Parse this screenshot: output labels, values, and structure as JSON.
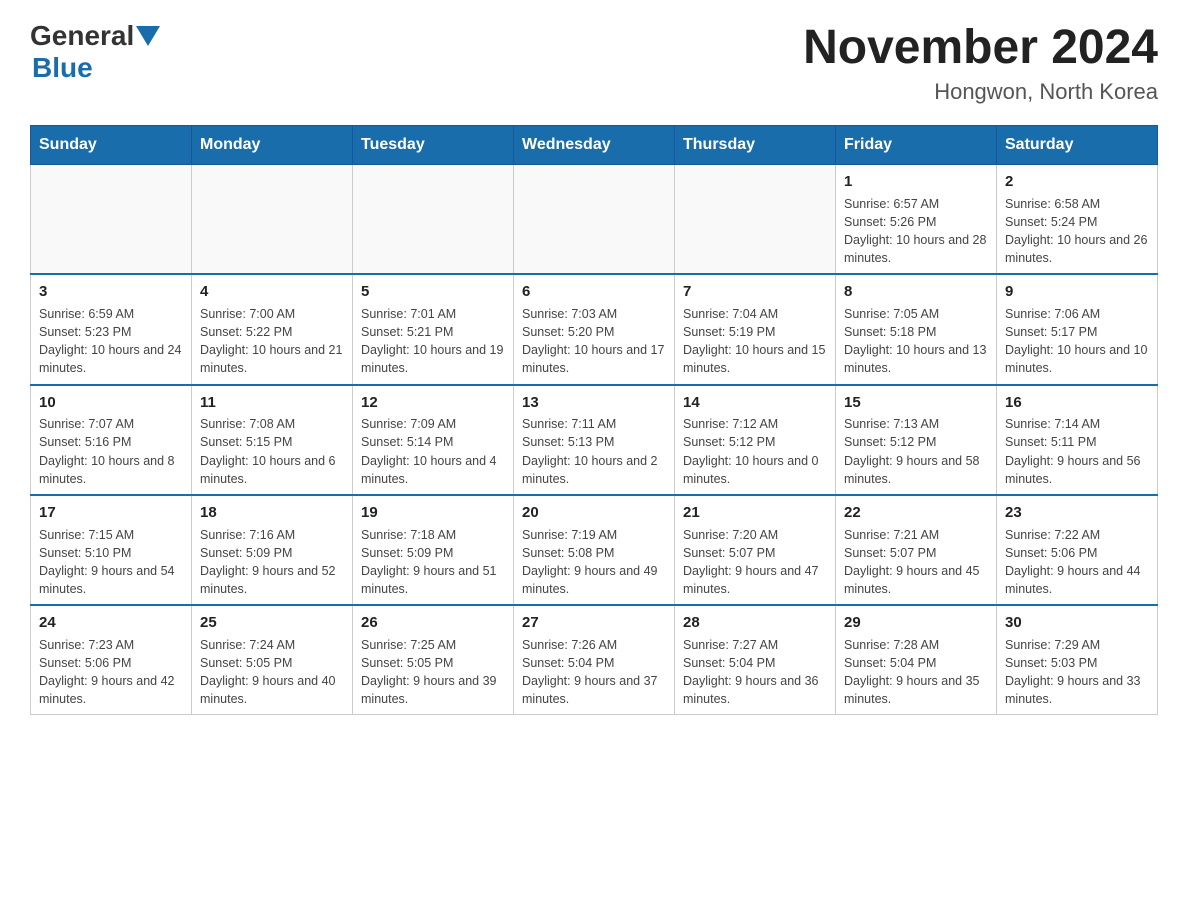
{
  "header": {
    "logo_general": "General",
    "logo_blue": "Blue",
    "month_title": "November 2024",
    "location": "Hongwon, North Korea"
  },
  "days_of_week": [
    "Sunday",
    "Monday",
    "Tuesday",
    "Wednesday",
    "Thursday",
    "Friday",
    "Saturday"
  ],
  "weeks": [
    {
      "days": [
        {
          "num": "",
          "info": ""
        },
        {
          "num": "",
          "info": ""
        },
        {
          "num": "",
          "info": ""
        },
        {
          "num": "",
          "info": ""
        },
        {
          "num": "",
          "info": ""
        },
        {
          "num": "1",
          "info": "Sunrise: 6:57 AM\nSunset: 5:26 PM\nDaylight: 10 hours and 28 minutes."
        },
        {
          "num": "2",
          "info": "Sunrise: 6:58 AM\nSunset: 5:24 PM\nDaylight: 10 hours and 26 minutes."
        }
      ]
    },
    {
      "days": [
        {
          "num": "3",
          "info": "Sunrise: 6:59 AM\nSunset: 5:23 PM\nDaylight: 10 hours and 24 minutes."
        },
        {
          "num": "4",
          "info": "Sunrise: 7:00 AM\nSunset: 5:22 PM\nDaylight: 10 hours and 21 minutes."
        },
        {
          "num": "5",
          "info": "Sunrise: 7:01 AM\nSunset: 5:21 PM\nDaylight: 10 hours and 19 minutes."
        },
        {
          "num": "6",
          "info": "Sunrise: 7:03 AM\nSunset: 5:20 PM\nDaylight: 10 hours and 17 minutes."
        },
        {
          "num": "7",
          "info": "Sunrise: 7:04 AM\nSunset: 5:19 PM\nDaylight: 10 hours and 15 minutes."
        },
        {
          "num": "8",
          "info": "Sunrise: 7:05 AM\nSunset: 5:18 PM\nDaylight: 10 hours and 13 minutes."
        },
        {
          "num": "9",
          "info": "Sunrise: 7:06 AM\nSunset: 5:17 PM\nDaylight: 10 hours and 10 minutes."
        }
      ]
    },
    {
      "days": [
        {
          "num": "10",
          "info": "Sunrise: 7:07 AM\nSunset: 5:16 PM\nDaylight: 10 hours and 8 minutes."
        },
        {
          "num": "11",
          "info": "Sunrise: 7:08 AM\nSunset: 5:15 PM\nDaylight: 10 hours and 6 minutes."
        },
        {
          "num": "12",
          "info": "Sunrise: 7:09 AM\nSunset: 5:14 PM\nDaylight: 10 hours and 4 minutes."
        },
        {
          "num": "13",
          "info": "Sunrise: 7:11 AM\nSunset: 5:13 PM\nDaylight: 10 hours and 2 minutes."
        },
        {
          "num": "14",
          "info": "Sunrise: 7:12 AM\nSunset: 5:12 PM\nDaylight: 10 hours and 0 minutes."
        },
        {
          "num": "15",
          "info": "Sunrise: 7:13 AM\nSunset: 5:12 PM\nDaylight: 9 hours and 58 minutes."
        },
        {
          "num": "16",
          "info": "Sunrise: 7:14 AM\nSunset: 5:11 PM\nDaylight: 9 hours and 56 minutes."
        }
      ]
    },
    {
      "days": [
        {
          "num": "17",
          "info": "Sunrise: 7:15 AM\nSunset: 5:10 PM\nDaylight: 9 hours and 54 minutes."
        },
        {
          "num": "18",
          "info": "Sunrise: 7:16 AM\nSunset: 5:09 PM\nDaylight: 9 hours and 52 minutes."
        },
        {
          "num": "19",
          "info": "Sunrise: 7:18 AM\nSunset: 5:09 PM\nDaylight: 9 hours and 51 minutes."
        },
        {
          "num": "20",
          "info": "Sunrise: 7:19 AM\nSunset: 5:08 PM\nDaylight: 9 hours and 49 minutes."
        },
        {
          "num": "21",
          "info": "Sunrise: 7:20 AM\nSunset: 5:07 PM\nDaylight: 9 hours and 47 minutes."
        },
        {
          "num": "22",
          "info": "Sunrise: 7:21 AM\nSunset: 5:07 PM\nDaylight: 9 hours and 45 minutes."
        },
        {
          "num": "23",
          "info": "Sunrise: 7:22 AM\nSunset: 5:06 PM\nDaylight: 9 hours and 44 minutes."
        }
      ]
    },
    {
      "days": [
        {
          "num": "24",
          "info": "Sunrise: 7:23 AM\nSunset: 5:06 PM\nDaylight: 9 hours and 42 minutes."
        },
        {
          "num": "25",
          "info": "Sunrise: 7:24 AM\nSunset: 5:05 PM\nDaylight: 9 hours and 40 minutes."
        },
        {
          "num": "26",
          "info": "Sunrise: 7:25 AM\nSunset: 5:05 PM\nDaylight: 9 hours and 39 minutes."
        },
        {
          "num": "27",
          "info": "Sunrise: 7:26 AM\nSunset: 5:04 PM\nDaylight: 9 hours and 37 minutes."
        },
        {
          "num": "28",
          "info": "Sunrise: 7:27 AM\nSunset: 5:04 PM\nDaylight: 9 hours and 36 minutes."
        },
        {
          "num": "29",
          "info": "Sunrise: 7:28 AM\nSunset: 5:04 PM\nDaylight: 9 hours and 35 minutes."
        },
        {
          "num": "30",
          "info": "Sunrise: 7:29 AM\nSunset: 5:03 PM\nDaylight: 9 hours and 33 minutes."
        }
      ]
    }
  ]
}
